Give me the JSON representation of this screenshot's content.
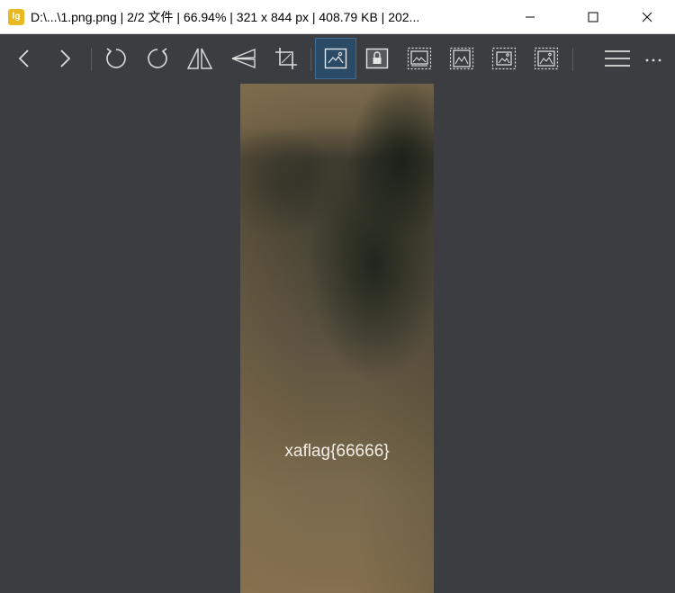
{
  "window": {
    "title": "D:\\...\\1.png.png  |  2/2 文件  |  66.94%  |  321 x 844 px  |  408.79 KB  |  202...",
    "app_icon_glyph": "lg",
    "minimize_icon": "minimize-icon",
    "maximize_icon": "maximize-icon",
    "close_icon": "close-icon"
  },
  "toolbar": {
    "items": [
      {
        "name": "prev-icon"
      },
      {
        "name": "next-icon"
      },
      {
        "name": "rotate-left-icon"
      },
      {
        "name": "rotate-right-icon"
      },
      {
        "name": "flip-horizontal-icon"
      },
      {
        "name": "flip-vertical-icon"
      },
      {
        "name": "crop-icon"
      },
      {
        "name": "fit-window-icon",
        "active": true
      },
      {
        "name": "lock-zoom-icon"
      },
      {
        "name": "actual-size-icon"
      },
      {
        "name": "fit-width-icon"
      },
      {
        "name": "fit-height-icon"
      },
      {
        "name": "fill-window-icon"
      },
      {
        "name": "menu-icon"
      },
      {
        "name": "more-icon"
      }
    ],
    "accent_color": "#2b4a66"
  },
  "image": {
    "overlay_text": "xaflag{66666}"
  }
}
